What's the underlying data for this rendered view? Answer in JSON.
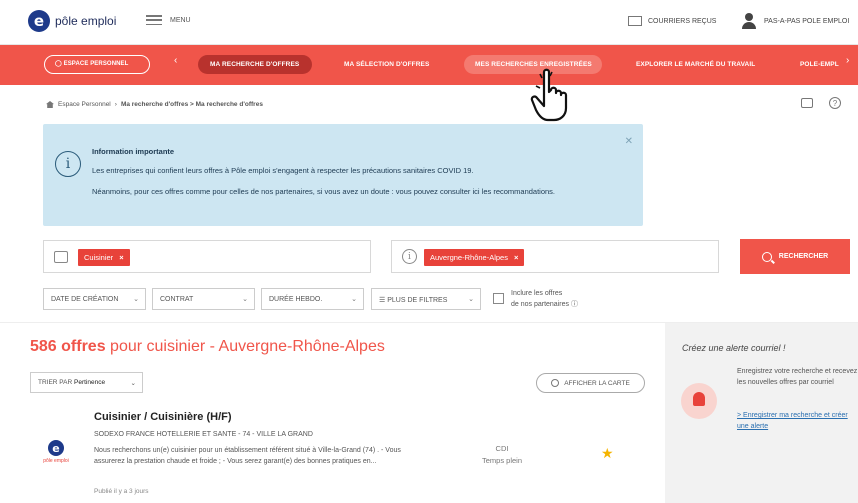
{
  "header": {
    "logo_text": "pôle emploi",
    "menu_label": "MENU",
    "courriers_label": "COURRIERS REÇUS",
    "user_label": "PAS-A-PAS POLE EMPLOI"
  },
  "nav": {
    "espace": "ESPACE PERSONNEL",
    "items": [
      "MA RECHERCHE D'OFFRES",
      "MA SÉLECTION D'OFFRES",
      "MES RECHERCHES ENREGISTRÉES",
      "EXPLORER LE MARCHÉ DU TRAVAIL",
      "POLE-EMPL"
    ]
  },
  "breadcrumb": {
    "items": [
      "Espace Personnel",
      "Ma recherche d'offres > Ma recherche d'offres"
    ]
  },
  "info": {
    "title": "Information importante",
    "line1": "Les entreprises qui confient leurs offres à Pôle emploi s'engagent à respecter les précautions sanitaires COVID 19.",
    "line2": "Néanmoins, pour ces offres comme pour celles de nos partenaires, si vous avez un doute : vous pouvez consulter ici les recommandations."
  },
  "search": {
    "job_tag": "Cuisinier",
    "location_tag": "Auvergne-Rhône-Alpes",
    "button_label": "RECHERCHER"
  },
  "filters": {
    "items": [
      "DATE DE CRÉATION",
      "CONTRAT",
      "DURÉE HEBDO.",
      "PLUS DE FILTRES"
    ],
    "include_line1": "Inclure les offres",
    "include_line2": "de nos partenaires"
  },
  "results": {
    "count": "586 offres",
    "rest": " pour cuisinier - Auvergne-Rhône-Alpes",
    "sort_label": "TRIER PAR",
    "sort_value": "Pertinence",
    "map_button": "AFFICHER LA CARTE"
  },
  "offer": {
    "title": "Cuisinier / Cuisinière (H/F)",
    "company": "SODEXO FRANCE HOTELLERIE ET SANTE - 74 - VILLE LA GRAND",
    "desc": "Nous recherchons un(e) cuisinier pour un établissement référent situé à Ville-la-Grand (74) . - Vous assurerez la prestation chaude et froide ; - Vous serez garant(e) des bonnes pratiques en...",
    "date": "Publié il y a 3 jours",
    "contract": "CDI",
    "time": "Temps plein",
    "logo_text": "pôle emploi"
  },
  "alert": {
    "title": "Créez une alerte courriel !",
    "text": "Enregistrez votre recherche et recevez les nouvelles offres par courriel",
    "link": "> Enregistrer ma recherche et créer une alerte"
  }
}
